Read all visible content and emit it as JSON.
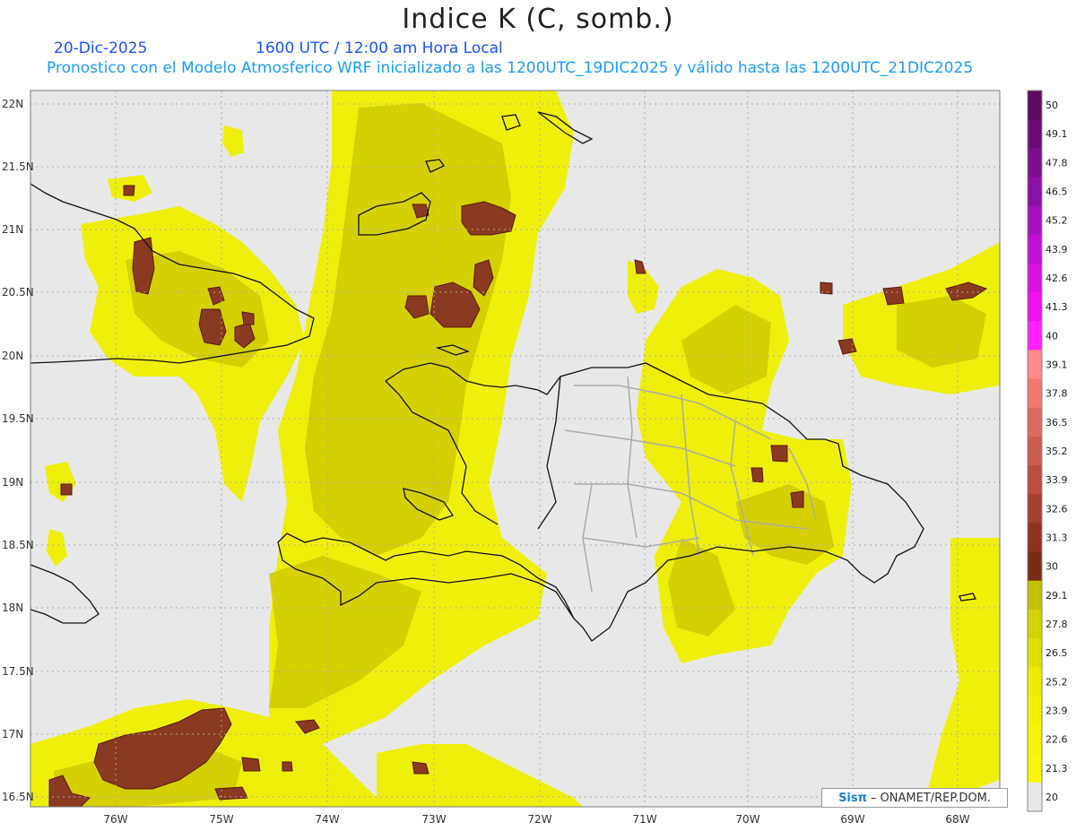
{
  "header": {
    "title": "Indice K (C, somb.)",
    "date": "20-Dic-2025",
    "time": "1600 UTC / 12:00 am Hora Local",
    "description": "Pronostico con el Modelo Atmosferico WRF inicializado a las 1200UTC_19DIC2025 y válido hasta las  1200UTC_21DIC2025"
  },
  "map": {
    "lat_labels": [
      "22N",
      "21.5N",
      "21N",
      "20.5N",
      "20N",
      "19.5N",
      "19N",
      "18.5N",
      "18N",
      "17.5N",
      "17N",
      "16.5N"
    ],
    "lon_labels": [
      "76W",
      "75W",
      "74W",
      "73W",
      "72W",
      "71W",
      "70W",
      "69W",
      "68W"
    ],
    "background_color": "#e8e8e8",
    "coast_color": "#111111",
    "border_color": "#aaaaaa"
  },
  "colorbar": {
    "labels": [
      "50",
      "49.1",
      "47.8",
      "46.5",
      "45.2",
      "43.9",
      "42.6",
      "41.3",
      "40",
      "39.1",
      "37.8",
      "36.5",
      "35.2",
      "33.9",
      "32.6",
      "31.3",
      "30",
      "29.1",
      "27.8",
      "26.5",
      "25.2",
      "23.9",
      "22.6",
      "21.3",
      "20"
    ],
    "colors": [
      "#5e0a5e",
      "#6a0a75",
      "#7b0d8e",
      "#8c10a8",
      "#a512c0",
      "#c010d4",
      "#d812e0",
      "#ee12ee",
      "#ff22ff",
      "#ff8888",
      "#ee7a72",
      "#dd6a60",
      "#cc5c50",
      "#bb4c40",
      "#a53e30",
      "#913220",
      "#7d2a16",
      "#c4c000",
      "#d6d200",
      "#e2de00",
      "#eeea00",
      "#f4f000",
      "#f8f400",
      "#fbf700",
      "#e8e8e8"
    ],
    "ranges_top": [
      "50",
      "49.1",
      "47.8",
      "46.5",
      "45.2",
      "43.9",
      "42.6",
      "41.3",
      "40",
      "39.1",
      "37.8",
      "36.5",
      "35.2",
      "33.9",
      "32.6",
      "31.3",
      "30",
      "29.1",
      "27.8",
      "26.5",
      "25.2",
      "23.9",
      "22.6",
      "21.3",
      "20"
    ]
  },
  "watermark": {
    "logo": "Sisπ",
    "text": "– ONAMET/REP.DOM."
  }
}
